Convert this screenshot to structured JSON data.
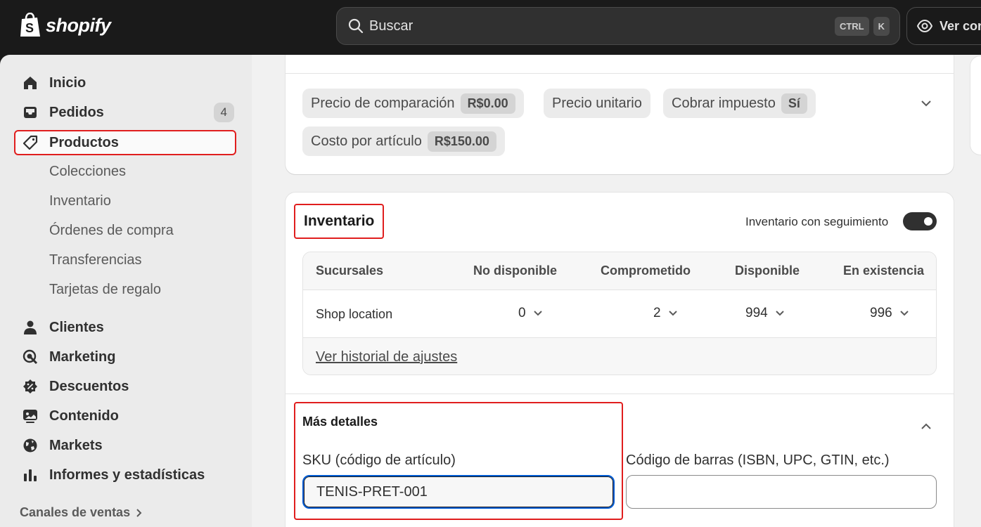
{
  "brand": {
    "name": "shopify"
  },
  "search": {
    "placeholder": "Buscar",
    "kbd1": "CTRL",
    "kbd2": "K"
  },
  "header": {
    "view_label": "Ver con"
  },
  "sidebar": {
    "items": [
      {
        "label": "Inicio",
        "icon": "home-icon"
      },
      {
        "label": "Pedidos",
        "icon": "inbox-icon",
        "badge": "4"
      },
      {
        "label": "Productos",
        "icon": "tag-icon"
      },
      {
        "label": "Clientes",
        "icon": "person-icon"
      },
      {
        "label": "Marketing",
        "icon": "target-icon"
      },
      {
        "label": "Descuentos",
        "icon": "discount-icon"
      },
      {
        "label": "Contenido",
        "icon": "content-icon"
      },
      {
        "label": "Markets",
        "icon": "globe-icon"
      },
      {
        "label": "Informes y estadísticas",
        "icon": "chart-icon"
      }
    ],
    "sub_items": [
      "Colecciones",
      "Inventario",
      "Órdenes de compra",
      "Transferencias",
      "Tarjetas de regalo"
    ],
    "channels": "Canales de ventas"
  },
  "pricing": {
    "compare_label": "Precio de comparación",
    "compare_value": "R$0.00",
    "unit_price": "Precio unitario",
    "tax_label": "Cobrar impuesto",
    "tax_value": "Sí",
    "cost_label": "Costo por artículo",
    "cost_value": "R$150.00"
  },
  "inventory": {
    "title": "Inventario",
    "tracking_label": "Inventario con seguimiento",
    "tracking_on": true,
    "columns": [
      "Sucursales",
      "No disponible",
      "Comprometido",
      "Disponible",
      "En existencia"
    ],
    "rows": [
      {
        "location": "Shop location",
        "unavailable": "0",
        "committed": "2",
        "available": "994",
        "on_hand": "996"
      }
    ],
    "history_link": "Ver historial de ajustes"
  },
  "details": {
    "title": "Más detalles",
    "sku_label": "SKU (código de artículo)",
    "sku_value": "TENIS-PRET-001",
    "barcode_label": "Código de barras (ISBN, UPC, GTIN, etc.)",
    "barcode_value": ""
  },
  "colors": {
    "highlight": "#e01e1e",
    "focus": "#005bd3",
    "topbar": "#1a1a1a"
  }
}
